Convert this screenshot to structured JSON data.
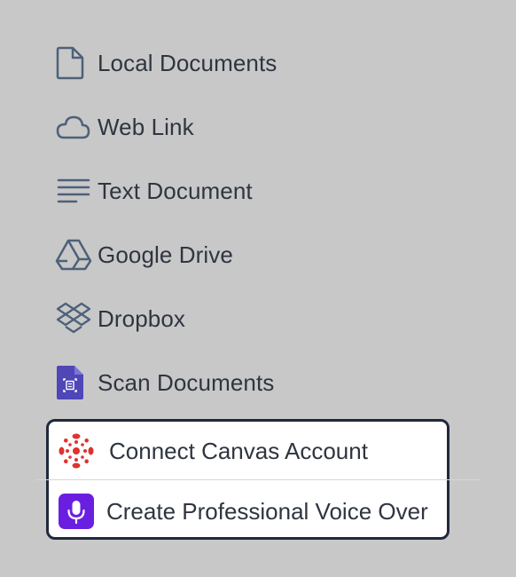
{
  "menu": {
    "items": [
      {
        "label": "Local Documents",
        "icon": "file-icon"
      },
      {
        "label": "Web Link",
        "icon": "cloud-icon"
      },
      {
        "label": "Text Document",
        "icon": "text-lines-icon"
      },
      {
        "label": "Google Drive",
        "icon": "google-drive-icon"
      },
      {
        "label": "Dropbox",
        "icon": "dropbox-icon"
      },
      {
        "label": "Scan Documents",
        "icon": "scan-document-icon"
      }
    ]
  },
  "popup": {
    "items": [
      {
        "label": "Connect Canvas Account",
        "icon": "canvas-logo-icon"
      },
      {
        "label": "Create Professional Voice Over",
        "icon": "microphone-icon"
      }
    ]
  },
  "colors": {
    "background": "#c8c8c8",
    "text": "#2f3540",
    "icon_stroke": "#4d6178",
    "scan_purple": "#4f46b8",
    "canvas_red": "#e0322d",
    "voice_purple": "#6a1fe0",
    "popup_border": "#1f2a3a"
  }
}
